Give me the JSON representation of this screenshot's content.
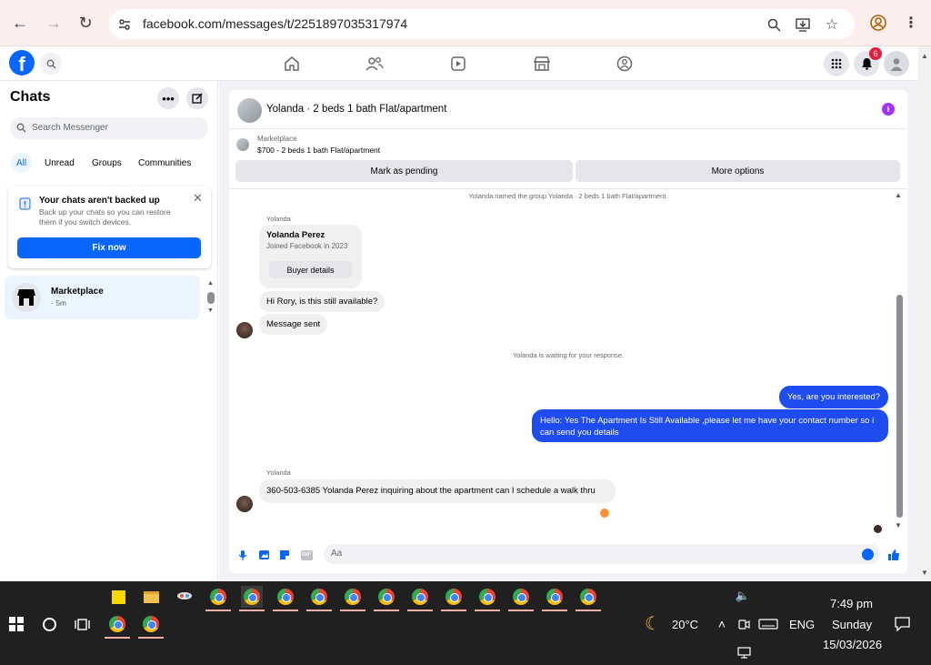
{
  "browser": {
    "url": "facebook.com/messages/t/2251897035317974",
    "icons": [
      "back-icon",
      "forward-icon",
      "reload-icon",
      "site-info-icon",
      "zoom-icon",
      "install-icon",
      "star-icon",
      "profile-icon",
      "menu-icon"
    ]
  },
  "fb": {
    "logo": "f",
    "notification_count": "6"
  },
  "sidebar": {
    "title": "Chats",
    "search_placeholder": "Search Messenger",
    "filters": [
      "All",
      "Unread",
      "Groups",
      "Communities"
    ],
    "backup": {
      "title": "Your chats aren't backed up",
      "subtitle": "Back up your chats so you can restore them if you switch devices.",
      "button": "Fix now"
    },
    "chat": {
      "name": "Marketplace",
      "time": "· 5m"
    }
  },
  "conversation": {
    "title": "Yolanda · 2 beds 1 bath Flat/apartment",
    "marketplace_label": "Marketplace",
    "listing": "$700 - 2 beds 1 bath Flat/apartment",
    "btn_pending": "Mark as pending",
    "btn_more": "More options",
    "system_named": "Yolanda named the group Yolanda · 2 beds 1 bath Flat/apartment.",
    "sender1": "Yolanda",
    "card_name": "Yolanda Perez",
    "card_joined": "Joined Facebook in 2023",
    "card_button": "Buyer details",
    "msg1": "Hi Rory, is this still available?",
    "msg2": "Message sent",
    "system_waiting": "Yolanda is waiting for your response.",
    "out1": "Yes, are you interested?",
    "out2": "Hello: Yes The Apartment Is Still Available ,please let me have your contact number so i can send you details",
    "sender2": "Yolanda",
    "msg3": "360-503-6385 Yolanda Perez inquiring about the apartment can I schedule a walk thru",
    "composer_placeholder": "Aa"
  },
  "taskbar": {
    "weather": "20°C",
    "lang": "ENG",
    "time": "7:49 pm",
    "day": "Sunday",
    "date": "15/03/2026"
  }
}
